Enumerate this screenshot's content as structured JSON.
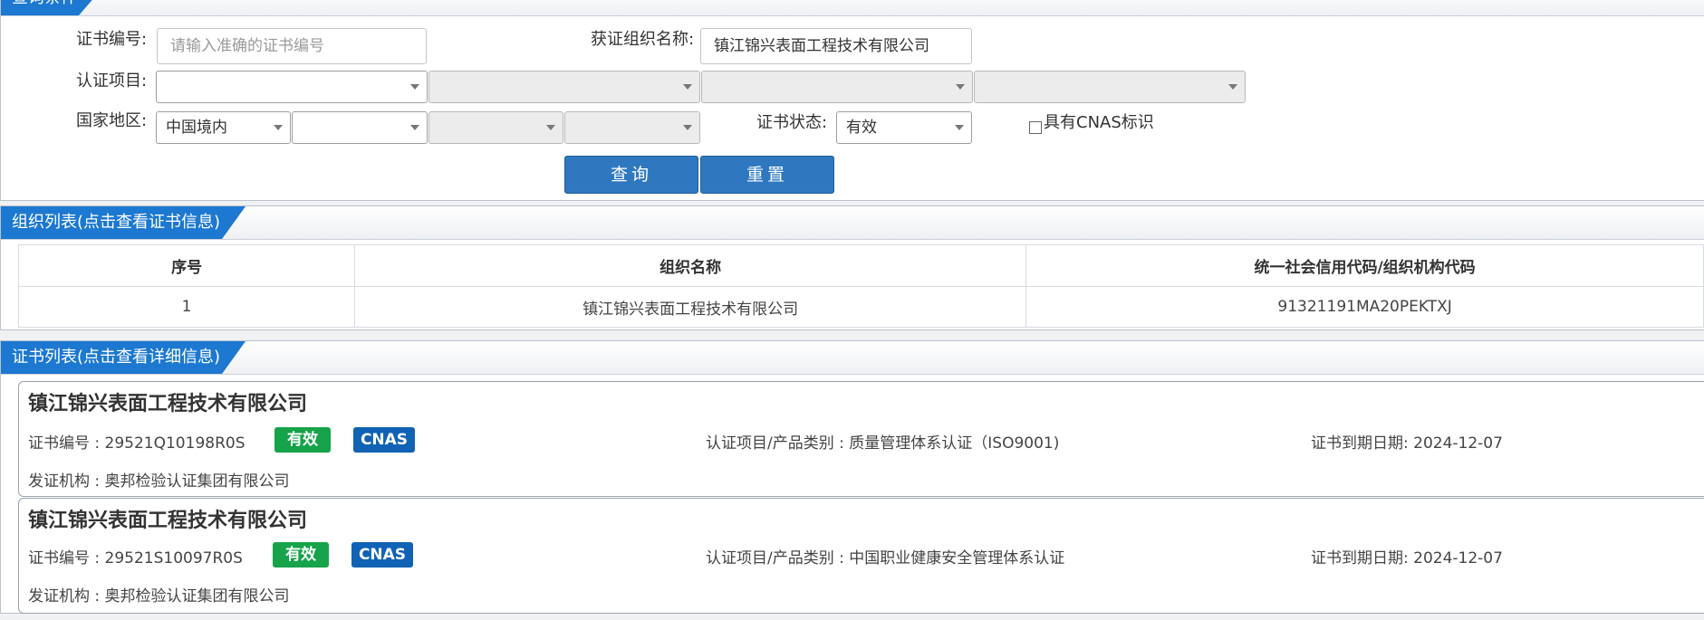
{
  "query_panel": {
    "title": "查询条件",
    "cert_no_label": "证书编号:",
    "cert_no_placeholder": "请输入准确的证书编号",
    "org_name_label": "获证组织名称:",
    "org_name_value": "镇江锦兴表面工程技术有限公司",
    "cert_item_label": "认证项目:",
    "region_label": "国家地区:",
    "region_value": "中国境内",
    "status_label": "证书状态:",
    "status_value": "有效",
    "cnas_label": "具有CNAS标识",
    "query_button": "查询",
    "reset_button": "重置"
  },
  "org_panel": {
    "title": "组织列表(点击查看证书信息)",
    "columns": [
      "序号",
      "组织名称",
      "统一社会信用代码/组织机构代码"
    ],
    "rows": [
      [
        "1",
        "镇江锦兴表面工程技术有限公司",
        "91321191MA20PEKTXJ"
      ]
    ]
  },
  "cert_panel": {
    "title": "证书列表(点击查看详细信息)",
    "certs": [
      {
        "org_name": "镇江锦兴表面工程技术有限公司",
        "cert_no": "证书编号 : 29521Q10198R0S",
        "status_badge": "有效",
        "cnas_badge": "CNAS",
        "item": "认证项目/产品类别 : 质量管理体系认证（ISO9001)",
        "expiry": "证书到期日期: 2024-12-07",
        "issuer": "发证机构 : 奥邦检验认证集团有限公司"
      },
      {
        "org_name": "镇江锦兴表面工程技术有限公司",
        "cert_no": "证书编号 : 29521S10097R0S",
        "status_badge": "有效",
        "cnas_badge": "CNAS",
        "item": "认证项目/产品类别 : 中国职业健康安全管理体系认证",
        "expiry": "证书到期日期: 2024-12-07",
        "issuer": "发证机构 : 奥邦检验认证集团有限公司"
      }
    ]
  },
  "colors": {
    "tab_blue": "#1c78d0",
    "button_blue": "#2f78c0",
    "badge_green": "#16a34a",
    "badge_blue": "#1162b4"
  }
}
